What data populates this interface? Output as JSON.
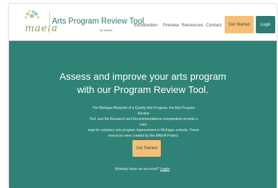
{
  "brand": {
    "logo_text": "maeia",
    "title": "Arts Program Review Tool",
    "subtitle": "By MAEIA"
  },
  "nav": {
    "links": [
      "Introduction",
      "Preview",
      "Resources",
      "Contact"
    ],
    "get_started": "Get Started",
    "login": "Login"
  },
  "hero": {
    "headline_line1": "Assess and improve your arts program",
    "headline_line2": "with our Program Review Tool.",
    "description_lines": [
      "The Michigan Blueprint of a Quality Arts Program, the Arts Program Review",
      "Tool, and the Research and Recommendations compendium provide a road-",
      "map for voluntary arts program improvement in Michigan schools. These",
      "resources were created by the MAEIA Project."
    ],
    "cta": "Get Started",
    "account_prompt": "Already have an account?",
    "account_link": "Login"
  },
  "colors": {
    "teal": "#2f8276",
    "brand_teal": "#2f7a74",
    "orange": "#f6bf78",
    "white": "#ffffff"
  }
}
